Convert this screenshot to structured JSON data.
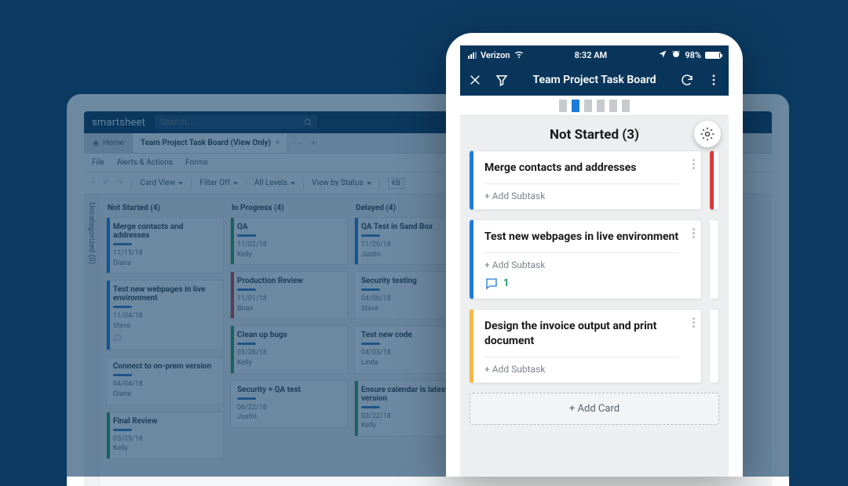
{
  "desktop": {
    "brand": "smartsheet",
    "search_placeholder": "Search…",
    "home_tab": "Home",
    "active_tab": "Team Project Task Board (View Only)",
    "menu": {
      "file": "File",
      "alerts": "Alerts & Actions",
      "forms": "Forms"
    },
    "toolbar": {
      "card_view": "Card View",
      "filter_off": "Filter Off",
      "all_levels": "All Levels",
      "view_by_status": "View by Status",
      "kb": "KB"
    },
    "sidecol": "Uncategorized (0)",
    "lanes": [
      {
        "header": "Not Started (4)",
        "cards": [
          {
            "title": "Merge contacts and addresses",
            "date": "11/15/18",
            "assignee": "Diana",
            "bar": "blue"
          },
          {
            "title": "Test new webpages in live environment",
            "date": "11/04/18",
            "assignee": "Steve",
            "bar": "blue",
            "hasComment": true
          },
          {
            "title": "Connect to on-prem version",
            "date": "04/04/18",
            "assignee": "Diana",
            "bar": ""
          },
          {
            "title": "Final Review",
            "date": "05/25/18",
            "assignee": "Kelly",
            "bar": "green"
          }
        ]
      },
      {
        "header": "In Progress (4)",
        "cards": [
          {
            "title": "QA",
            "date": "11/02/18",
            "assignee": "Kelly",
            "bar": "green"
          },
          {
            "title": "Production Review",
            "date": "11/01/18",
            "assignee": "Brian",
            "bar": "red"
          },
          {
            "title": "Clean up bugs",
            "date": "03/28/18",
            "assignee": "Kelly",
            "bar": "green"
          },
          {
            "title": "Security + QA test",
            "date": "06/22/18",
            "assignee": "Justin",
            "bar": ""
          }
        ]
      },
      {
        "header": "Delayed (4)",
        "cards": [
          {
            "title": "QA\nTest in Sand Box",
            "date": "11/26/18",
            "assignee": "Justin",
            "bar": "blue"
          },
          {
            "title": "Security testing",
            "date": "04/06/18",
            "assignee": "Steve",
            "bar": ""
          },
          {
            "title": "Test new code",
            "date": "04/03/18",
            "assignee": "Linda",
            "bar": ""
          },
          {
            "title": "Ensure calendar is latest version",
            "date": "03/22/18",
            "assignee": "Kelly",
            "bar": "green"
          }
        ]
      }
    ]
  },
  "phone": {
    "status": {
      "carrier": "Verizon",
      "time": "8:32 AM",
      "battery_pct": "98%"
    },
    "appbar_title": "Team Project Task Board",
    "column_title": "Not Started (3)",
    "add_subtask": "+ Add Subtask",
    "add_card": "+ Add Card",
    "cards": [
      {
        "title": "Merge contacts and addresses",
        "bar": "blue"
      },
      {
        "title": "Test new webpages in live environment",
        "bar": "blue",
        "comments": "1"
      },
      {
        "title": "Design the invoice output and print document",
        "bar": "yell"
      }
    ]
  }
}
